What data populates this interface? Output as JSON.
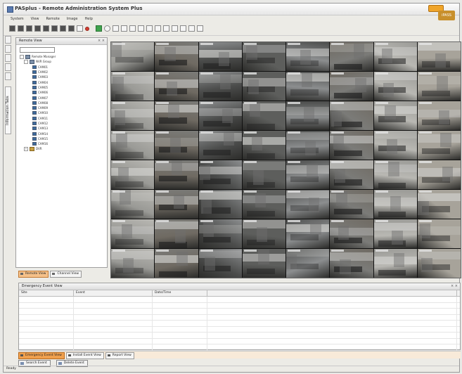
{
  "window": {
    "title": "PASplus - Remote Administration System Plus",
    "brand_label": "iPASS",
    "colors": {
      "accent": "#f0a04e",
      "brand": "#c8902c",
      "video_bg": "#101010"
    }
  },
  "menu": [
    "System",
    "View",
    "Remote",
    "Image",
    "Help"
  ],
  "toolbar": {
    "buttons": [
      "tool-1",
      "tool-2",
      "tool-3",
      "tool-4",
      "tool-5",
      "tool-6",
      "tool-7",
      "tool-8",
      "tool-9",
      "record",
      "live",
      "layout-1",
      "layout-4",
      "layout-6",
      "layout-8",
      "layout-9",
      "layout-10",
      "layout-13",
      "layout-16",
      "layout-20",
      "layout-25",
      "layout-36",
      "layout-64"
    ]
  },
  "side_tabs": {
    "label": "Information Tabs"
  },
  "tree_panel": {
    "title": "Remote View",
    "close_glyph": "× ×",
    "nodes": [
      {
        "label": "Remote Manager",
        "level": 0,
        "type": "root",
        "expander": "-"
      },
      {
        "label": "NVR Group",
        "level": 1,
        "type": "group",
        "expander": "-"
      },
      {
        "label": "CAM01",
        "level": 3,
        "type": "camera"
      },
      {
        "label": "CAM02",
        "level": 3,
        "type": "camera"
      },
      {
        "label": "CAM03",
        "level": 3,
        "type": "camera"
      },
      {
        "label": "CAM04",
        "level": 3,
        "type": "camera"
      },
      {
        "label": "CAM05",
        "level": 3,
        "type": "camera"
      },
      {
        "label": "CAM06",
        "level": 3,
        "type": "camera"
      },
      {
        "label": "CAM07",
        "level": 3,
        "type": "camera"
      },
      {
        "label": "CAM08",
        "level": 3,
        "type": "camera"
      },
      {
        "label": "CAM09",
        "level": 3,
        "type": "camera"
      },
      {
        "label": "CAM10",
        "level": 3,
        "type": "camera"
      },
      {
        "label": "CAM11",
        "level": 3,
        "type": "camera"
      },
      {
        "label": "CAM12",
        "level": 3,
        "type": "camera"
      },
      {
        "label": "CAM13",
        "level": 3,
        "type": "camera"
      },
      {
        "label": "CAM14",
        "level": 3,
        "type": "camera"
      },
      {
        "label": "CAM15",
        "level": 3,
        "type": "camera"
      },
      {
        "label": "CAM16",
        "level": 3,
        "type": "camera"
      },
      {
        "label": "DVR",
        "level": 1,
        "type": "pc",
        "expander": "+"
      }
    ],
    "tabs": [
      {
        "label": "Remote View",
        "active": true
      },
      {
        "label": "Channel View",
        "active": false
      }
    ]
  },
  "video_grid": {
    "columns": 8,
    "rows": 8,
    "camera_count": 64
  },
  "event_panel": {
    "title": "Emergency Event View",
    "close_glyph": "× ×",
    "columns": [
      "Site",
      "Event",
      "Date/Time",
      ""
    ],
    "row_count": 10
  },
  "bottom_tabs": [
    {
      "label": "Emergency Event View",
      "active": true
    },
    {
      "label": "Install Event View",
      "active": false
    },
    {
      "label": "Report View",
      "active": false
    }
  ],
  "action_buttons": [
    "Search Event",
    "Delete Event"
  ],
  "status": "Ready"
}
